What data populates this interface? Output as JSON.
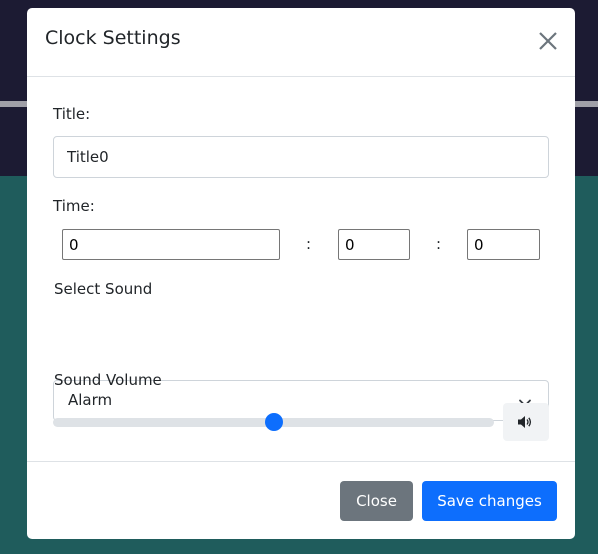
{
  "modal": {
    "title": "Clock Settings",
    "title_label": "Title:",
    "title_value": "Title0",
    "time_label": "Time:",
    "time": {
      "hours": "0",
      "minutes": "0",
      "seconds": "0",
      "separator": ":"
    },
    "sound_label": "Select Sound",
    "sound_selected": "Alarm",
    "volume_label": "Sound Volume",
    "volume_fraction": 0.5,
    "close_button": "Close",
    "save_button": "Save changes"
  },
  "colors": {
    "primary": "#0d6efd",
    "secondary": "#6c757d",
    "backdrop_top": "#1c1b33",
    "backdrop_bottom": "#1f5c5c"
  },
  "icons": {
    "close": "close-icon",
    "chevron": "chevron-down-icon",
    "speaker": "speaker-volume-icon"
  }
}
